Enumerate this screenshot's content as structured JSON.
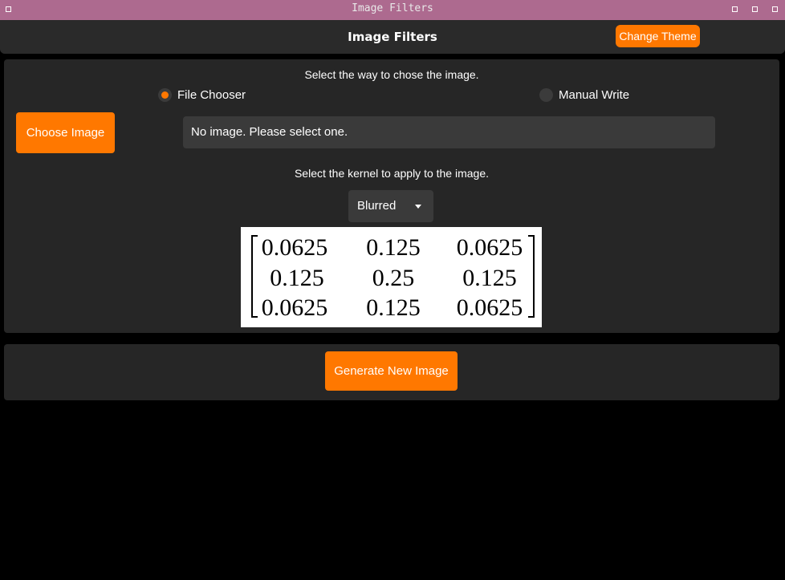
{
  "window": {
    "title": "Image Filters"
  },
  "header": {
    "title": "Image Filters",
    "change_theme_label": "Change Theme"
  },
  "source": {
    "prompt": "Select the way to chose the image.",
    "options": [
      {
        "label": "File Chooser",
        "selected": true
      },
      {
        "label": "Manual Write",
        "selected": false
      }
    ],
    "choose_button_label": "Choose Image",
    "path_text": "No image. Please select one."
  },
  "kernel": {
    "prompt": "Select the kernel to apply to the image.",
    "selected": "Blurred",
    "matrix": [
      [
        "0.0625",
        "0.125",
        "0.0625"
      ],
      [
        "0.125",
        "0.25",
        "0.125"
      ],
      [
        "0.0625",
        "0.125",
        "0.0625"
      ]
    ]
  },
  "actions": {
    "generate_label": "Generate New Image"
  },
  "colors": {
    "accent": "#ff7800",
    "titlebar": "#ad6a8f",
    "panel": "#262626",
    "background": "#000000"
  }
}
